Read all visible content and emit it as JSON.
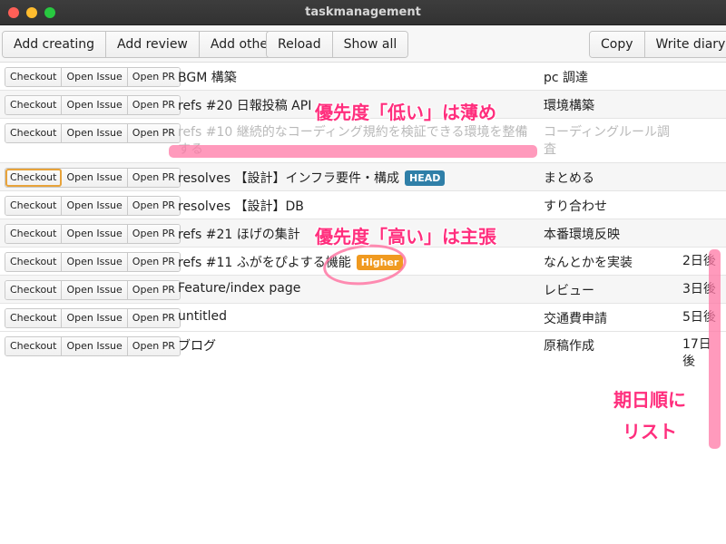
{
  "window": {
    "title": "taskmanagement"
  },
  "toolbar": {
    "left_group_1": [
      "Add creating",
      "Add review",
      "Add other"
    ],
    "left_group_2": [
      "Reload",
      "Show all"
    ],
    "right_group": [
      "Copy",
      "Write diary"
    ]
  },
  "row_actions": [
    "Checkout",
    "Open Issue",
    "Open PR"
  ],
  "tasks": [
    {
      "title": "BGM 構築",
      "assignee": "pc 調達",
      "due": ""
    },
    {
      "title": "refs #20 日報投稿 API",
      "assignee": "環境構築",
      "due": ""
    },
    {
      "title": "refs #10 継続的なコーディング規約を検証できる環境を整備する",
      "assignee": "コーディングルール調査",
      "due": "",
      "low_priority": true
    },
    {
      "title": "resolves 【設計】インフラ要件・構成",
      "badge": "HEAD",
      "assignee": "まとめる",
      "due": ""
    },
    {
      "title": "resolves 【設計】DB",
      "assignee": "すり合わせ",
      "due": ""
    },
    {
      "title": "refs #21 ほげの集計",
      "assignee": "本番環境反映",
      "due": ""
    },
    {
      "title": "refs #11 ふがをぴよする機能",
      "badge": "Higher",
      "assignee": "なんとかを実装",
      "due": "2日後"
    },
    {
      "title": "Feature/index page",
      "assignee": "レビュー",
      "due": "3日後"
    },
    {
      "title": "untitled",
      "assignee": "交通費申請",
      "due": "5日後"
    },
    {
      "title": "ブログ",
      "assignee": "原稿作成",
      "due": "17日後"
    }
  ],
  "annotations": {
    "low_priority": "優先度「低い」は薄め",
    "high_priority": "優先度「高い」は主張",
    "sorted_line1": "期日順に",
    "sorted_line2": "リスト"
  },
  "colors": {
    "annotation": "#ff2e7d",
    "badge_head": "#2f7fa8",
    "badge_higher": "#f09a20",
    "faded_text": "#b9b9b9"
  }
}
